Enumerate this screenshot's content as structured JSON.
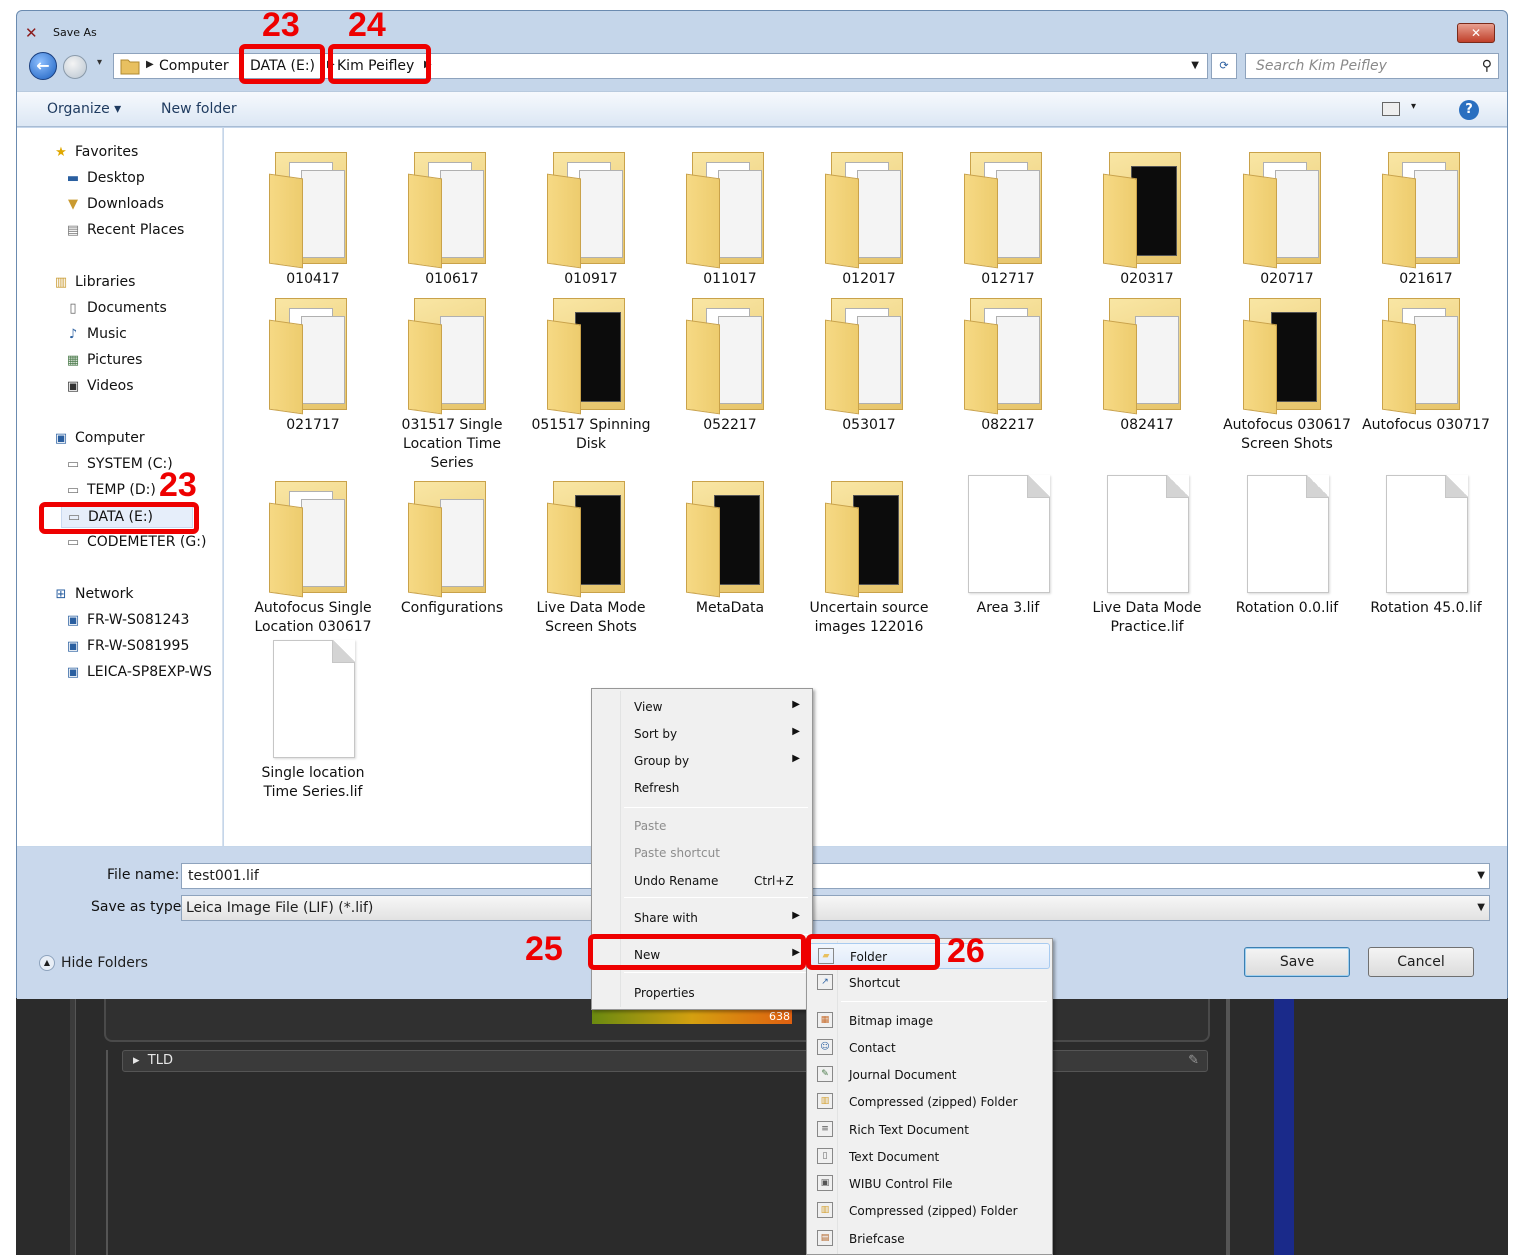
{
  "dialog": {
    "title": "Save As",
    "close_label": "✕"
  },
  "nav_bar": {
    "breadcrumbs": [
      "Computer",
      "DATA (E:)",
      "Kim Peifley"
    ],
    "search_placeholder": "Search Kim Peifley"
  },
  "toolbar": {
    "organize": "Organize ▾",
    "new_folder": "New folder",
    "help": "?"
  },
  "nav_pane": {
    "favorites": {
      "header": "Favorites",
      "items": [
        "Desktop",
        "Downloads",
        "Recent Places"
      ]
    },
    "libraries": {
      "header": "Libraries",
      "items": [
        "Documents",
        "Music",
        "Pictures",
        "Videos"
      ]
    },
    "computer": {
      "header": "Computer",
      "items": [
        "SYSTEM (C:)",
        "TEMP (D:)",
        "DATA (E:)",
        "CODEMETER (G:)"
      ]
    },
    "network": {
      "header": "Network",
      "items": [
        "FR-W-S081243",
        "FR-W-S081995",
        "LEICA-SP8EXP-WS"
      ]
    }
  },
  "files": [
    {
      "name": "010417",
      "kind": "folder"
    },
    {
      "name": "010617",
      "kind": "folder"
    },
    {
      "name": "010917",
      "kind": "folder"
    },
    {
      "name": "011017",
      "kind": "folder"
    },
    {
      "name": "012017",
      "kind": "folder"
    },
    {
      "name": "012717",
      "kind": "folder"
    },
    {
      "name": "020317",
      "kind": "folder-image"
    },
    {
      "name": "020717",
      "kind": "folder"
    },
    {
      "name": "021617",
      "kind": "folder"
    },
    {
      "name": "021717",
      "kind": "folder"
    },
    {
      "name": "031517 Single Location Time Series",
      "kind": "folder-doc"
    },
    {
      "name": "051517 Spinning Disk",
      "kind": "folder-image"
    },
    {
      "name": "052217",
      "kind": "folder"
    },
    {
      "name": "053017",
      "kind": "folder"
    },
    {
      "name": "082217",
      "kind": "folder"
    },
    {
      "name": "082417",
      "kind": "folder-doc"
    },
    {
      "name": "Autofocus 030617 Screen Shots",
      "kind": "folder-image"
    },
    {
      "name": "Autofocus 030717",
      "kind": "folder"
    },
    {
      "name": "Autofocus Single Location 030617",
      "kind": "folder"
    },
    {
      "name": "Configurations",
      "kind": "folder-doc"
    },
    {
      "name": "Live Data Mode Screen Shots",
      "kind": "folder-image"
    },
    {
      "name": "MetaData",
      "kind": "folder-image"
    },
    {
      "name": "Uncertain source images 122016",
      "kind": "folder-image"
    },
    {
      "name": "Area 3.lif",
      "kind": "file"
    },
    {
      "name": "Live Data Mode Practice.lif",
      "kind": "file"
    },
    {
      "name": "Rotation 0.0.lif",
      "kind": "file"
    },
    {
      "name": "Rotation 45.0.lif",
      "kind": "file"
    },
    {
      "name": "Single location Time Series.lif",
      "kind": "file"
    }
  ],
  "bottom": {
    "file_name_label": "File name:",
    "file_name_value": "test001.lif",
    "save_type_label": "Save as type:",
    "save_type_value": "Leica Image File (LIF) (*.lif)",
    "hide_folders": "Hide Folders",
    "save": "Save",
    "cancel": "Cancel"
  },
  "context_menu": {
    "items": [
      {
        "label": "View",
        "submenu": true,
        "disabled": false
      },
      {
        "label": "Sort by",
        "submenu": true,
        "disabled": false
      },
      {
        "label": "Group by",
        "submenu": true,
        "disabled": false
      },
      {
        "label": "Refresh",
        "submenu": false,
        "disabled": false
      },
      {
        "label": "Paste",
        "submenu": false,
        "disabled": true
      },
      {
        "label": "Paste shortcut",
        "submenu": false,
        "disabled": true
      },
      {
        "label": "Undo Rename",
        "shortcut": "Ctrl+Z",
        "submenu": false,
        "disabled": false
      },
      {
        "label": "Share with",
        "submenu": true,
        "disabled": false
      },
      {
        "label": "New",
        "submenu": true,
        "disabled": false
      },
      {
        "label": "Properties",
        "submenu": false,
        "disabled": false
      }
    ]
  },
  "new_submenu": {
    "items": [
      "Folder",
      "Shortcut",
      "Bitmap image",
      "Contact",
      "Journal Document",
      "Compressed (zipped) Folder",
      "Rich Text Document",
      "Text Document",
      "WIBU Control File",
      "Compressed (zipped) Folder",
      "Briefcase"
    ]
  },
  "background_app": {
    "colorbar_max": "638",
    "panel_label": "TLD"
  },
  "annotations": {
    "breadcrumb_drive": "23",
    "breadcrumb_user": "24",
    "nav_drive": "23",
    "menu_new": "25",
    "menu_folder": "26",
    "color": "#ee0000"
  }
}
